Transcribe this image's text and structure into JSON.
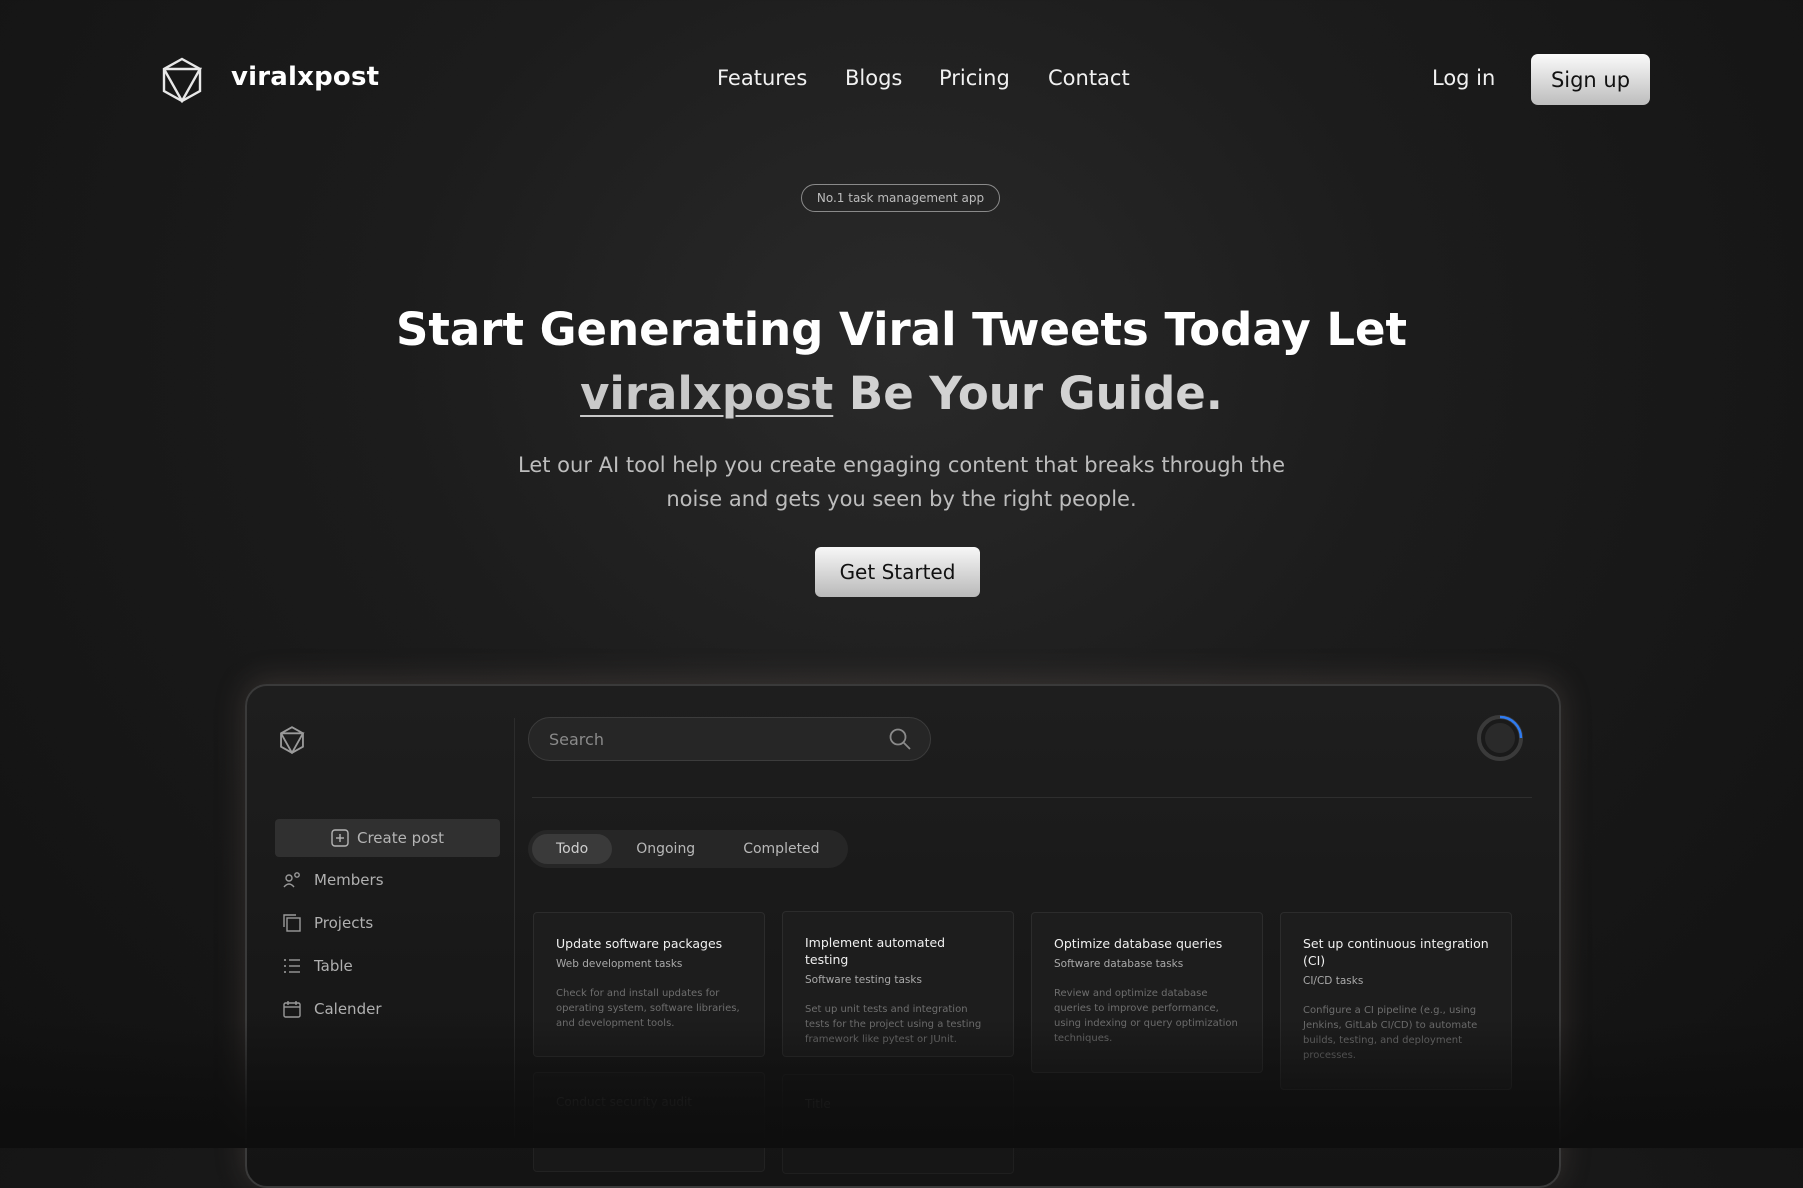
{
  "nav": {
    "brand": "viralxpost",
    "links": [
      "Features",
      "Blogs",
      "Pricing",
      "Contact"
    ],
    "login": "Log in",
    "signup": "Sign up"
  },
  "hero": {
    "badge": "No.1 task management app",
    "headline_line1": "Start Generating Viral Tweets Today Let",
    "headline_brand": "viralxpost",
    "headline_rest": " Be Your Guide.",
    "subtext": "Let our AI tool help you create engaging content that breaks through the noise and gets you seen by the right people.",
    "cta": "Get Started"
  },
  "app": {
    "search_placeholder": "Search",
    "create_post": "Create post",
    "sidebar": [
      "Members",
      "Projects",
      "Table",
      "Calender"
    ],
    "tabs": [
      "Todo",
      "Ongoing",
      "Completed"
    ],
    "active_tab": "Todo",
    "cards": [
      {
        "title": "Update software packages",
        "subtitle": "Web development tasks",
        "desc": "Check for and install updates for operating system, software libraries, and development tools."
      },
      {
        "title": "Implement automated testing",
        "subtitle": "Software testing tasks",
        "desc": "Set up unit tests and integration tests for the project using a testing framework like pytest or JUnit."
      },
      {
        "title": "Optimize database queries",
        "subtitle": "Software database tasks",
        "desc": "Review and optimize database queries to improve performance, using indexing or query optimization techniques."
      },
      {
        "title": "Set up continuous integration (CI)",
        "subtitle": "CI/CD tasks",
        "desc": "Configure a CI pipeline (e.g., using Jenkins, GitLab CI/CD) to automate builds, testing, and deployment processes."
      }
    ],
    "ghost_cards": [
      "Conduct security audit",
      "Title"
    ]
  }
}
